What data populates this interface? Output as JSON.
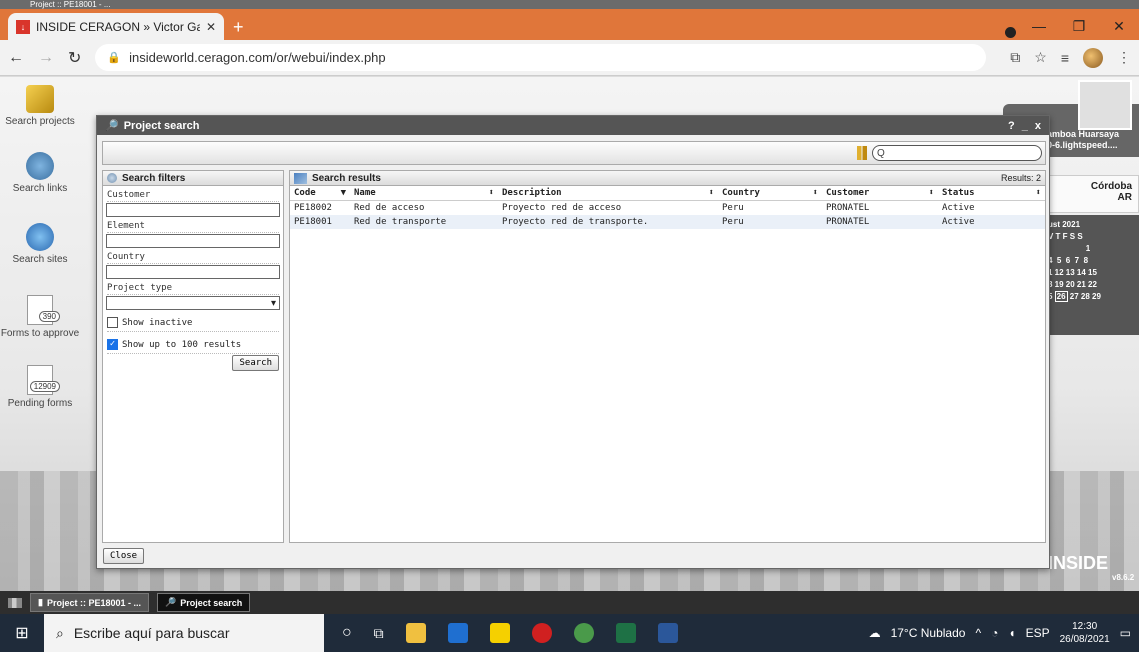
{
  "os_top_strip": "Project :: PE18001 - ...",
  "browser": {
    "tab_title": "INSIDE CERAGON » Victor Gamb",
    "url": "insideworld.ceragon.com/or/webui/index.php"
  },
  "sidebar": {
    "items": [
      {
        "label": "Search projects",
        "icon": "folder-icon"
      },
      {
        "label": "Search links",
        "icon": "link-icon"
      },
      {
        "label": "Search sites",
        "icon": "globe-icon"
      },
      {
        "label": "Forms to approve",
        "badge": "390"
      },
      {
        "label": "Pending forms",
        "badge": "12909"
      }
    ]
  },
  "user_card": {
    "name": "amboa Huarsaya",
    "host": "0-6.lightspeed...."
  },
  "weather": {
    "city": "Córdoba",
    "country": "AR"
  },
  "calendar": {
    "month": "ust 2021",
    "header": "V  T  F  S  S",
    "today": "26"
  },
  "brand": {
    "name": "INSIDE",
    "version": "v8.6.2"
  },
  "modal": {
    "title": "Project search",
    "controls": [
      "?",
      "_",
      "x"
    ],
    "search_placeholder": "Q",
    "filters": {
      "title": "Search filters",
      "customer_label": "Customer",
      "element_label": "Element",
      "country_label": "Country",
      "project_type_label": "Project type",
      "show_inactive_label": "Show inactive",
      "show_inactive_checked": false,
      "show_up_to_label": "Show up to 100 results",
      "show_up_to_checked": true,
      "search_button": "Search"
    },
    "results": {
      "title": "Search results",
      "count_label": "Results: 2",
      "columns": [
        "Code",
        "Name",
        "Description",
        "Country",
        "Customer",
        "Status"
      ],
      "rows": [
        {
          "code": "PE18002",
          "name": "Red de acceso",
          "description": "Proyecto red de acceso",
          "country": "Peru",
          "customer": "PRONATEL",
          "status": "Active"
        },
        {
          "code": "PE18001",
          "name": "Red de transporte",
          "description": "Proyecto red de transporte.",
          "country": "Peru",
          "customer": "PRONATEL",
          "status": "Active"
        }
      ]
    },
    "close_button": "Close"
  },
  "app_taskbar": {
    "tasks": [
      "Project :: PE18001 - ...",
      "Project search"
    ]
  },
  "windows_taskbar": {
    "search_placeholder": "Escribe aquí para buscar",
    "weather": "17°C  Nublado",
    "language": "ESP",
    "time": "12:30",
    "date": "26/08/2021"
  }
}
